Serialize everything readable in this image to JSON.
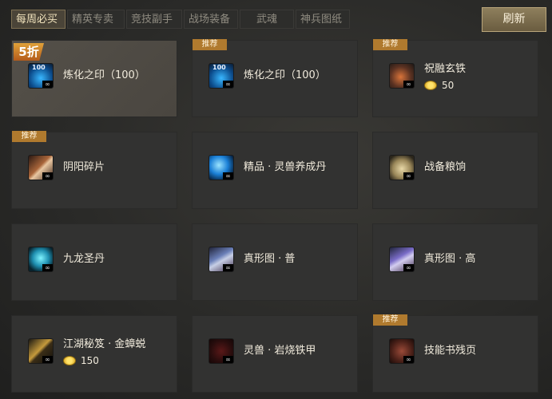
{
  "tabs": [
    "每周必买",
    "精英专卖",
    "竞技副手",
    "战场装备",
    "武魂",
    "神兵图纸"
  ],
  "refresh_label": "刷新",
  "tag_recommend": "推荐",
  "discount_label": "5折",
  "icon_count": "100",
  "infinity_glyph": "∞",
  "items": [
    {
      "name": "炼化之印（100）",
      "icon": "refine-seal-icon",
      "tag": "discount"
    },
    {
      "name": "炼化之印（100）",
      "icon": "refine-seal-icon",
      "tag": "recommend"
    },
    {
      "name": "祝融玄铁",
      "icon": "zhurong-iron-icon",
      "tag": "recommend",
      "price": "50"
    },
    {
      "name": "阴阳碎片",
      "icon": "yinyang-shard-icon",
      "tag": "recommend"
    },
    {
      "name": "精品 · 灵兽养成丹",
      "icon": "spirit-pill-icon"
    },
    {
      "name": "战备粮饷",
      "icon": "ration-bag-icon"
    },
    {
      "name": "九龙圣丹",
      "icon": "dragon-pill-icon"
    },
    {
      "name": "真形图 · 普",
      "icon": "scroll-normal-icon"
    },
    {
      "name": "真形图 · 高",
      "icon": "scroll-high-icon"
    },
    {
      "name": "江湖秘笈 · 金蟑蜕",
      "icon": "manual-icon",
      "price": "150"
    },
    {
      "name": "灵兽 · 岩烧铁甲",
      "icon": "beast-armor-icon"
    },
    {
      "name": "技能书残页",
      "icon": "skillbook-page-icon",
      "tag": "recommend"
    }
  ],
  "colors": {
    "accent": "#b07a2e",
    "button": "#8e7f5d",
    "card": "#323231"
  }
}
